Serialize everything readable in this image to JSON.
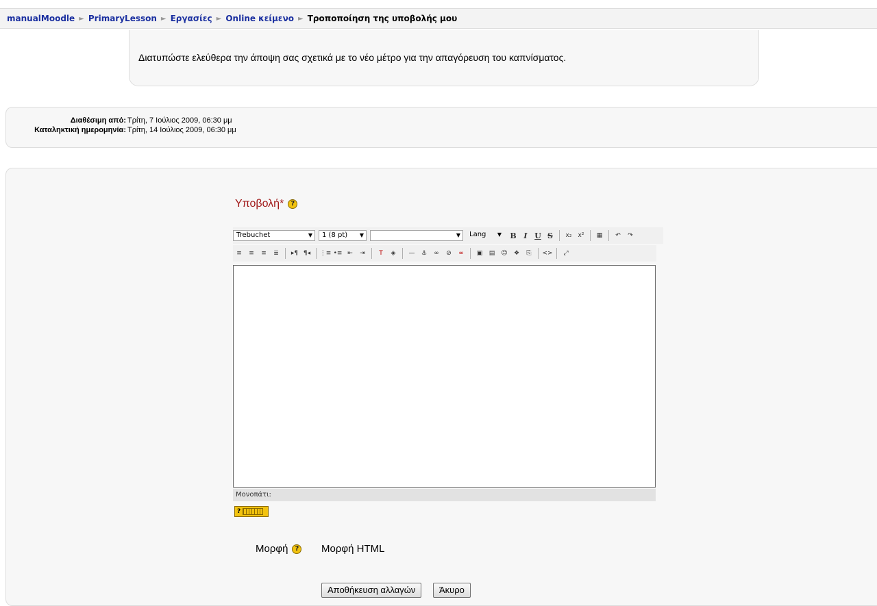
{
  "breadcrumb": {
    "items": [
      "manualMoodle",
      "PrimaryLesson",
      "Εργασίες",
      "Online κείμενο"
    ],
    "current": "Τροποποίηση της υποβολής μου"
  },
  "intro": {
    "text": "Διατυπώστε ελεύθερα την άποψη σας σχετικά με το νέο μέτρο για την απαγόρευση του καπνίσματος."
  },
  "dates": {
    "available_label": "Διαθέσιμη από:",
    "available_value": "Τρίτη, 7 Ιούλιος 2009, 06:30 μμ",
    "due_label": "Καταληκτική ημερομηνία:",
    "due_value": "Τρίτη, 14 Ιούλιος 2009, 06:30 μμ"
  },
  "form": {
    "submission_label": "Υποβολή*",
    "help_glyph": "?",
    "editor": {
      "font_family": "Trebuchet",
      "font_size": "1 (8 pt)",
      "style": "",
      "lang": "Lang",
      "path_label": "Μονοπάτι:",
      "content": "",
      "keyboard_help": "?"
    },
    "format_label": "Μορφή",
    "format_value": "Μορφή HTML",
    "save_button": "Αποθήκευση αλλαγών",
    "cancel_button": "Άκυρο"
  },
  "toolbar_icons": {
    "row1": [
      "bold-icon",
      "italic-icon",
      "underline-icon",
      "strikethrough-icon",
      "subscript-icon",
      "superscript-icon",
      "clean-word-icon",
      "undo-icon",
      "redo-icon"
    ],
    "row2": [
      "align-left-icon",
      "align-center-icon",
      "align-right-icon",
      "justify-icon",
      "ltr-icon",
      "rtl-icon",
      "ordered-list-icon",
      "unordered-list-icon",
      "outdent-icon",
      "indent-icon",
      "text-color-icon",
      "background-color-icon",
      "horizontal-rule-icon",
      "anchor-icon",
      "link-icon",
      "unlink-icon",
      "nolink-icon",
      "image-icon",
      "table-icon",
      "smiley-icon",
      "special-char-icon",
      "search-replace-icon",
      "html-source-icon",
      "fullscreen-icon"
    ]
  },
  "colors": {
    "link": "#1a2fa0",
    "label_required": "#a01818",
    "help_icon": "#f2c30f"
  }
}
